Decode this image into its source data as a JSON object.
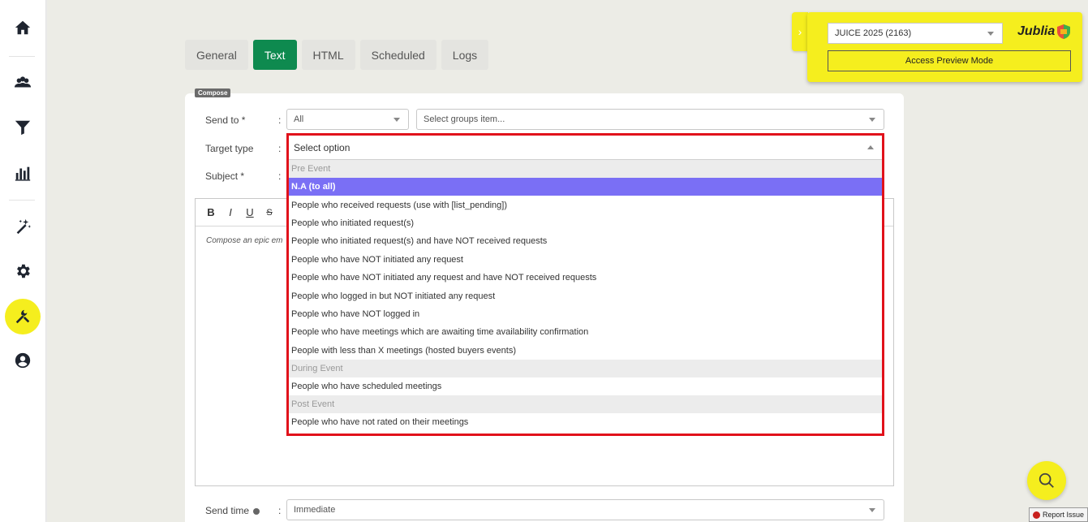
{
  "sidebar": {
    "items": [
      {
        "name": "home-icon"
      },
      {
        "name": "users-icon"
      },
      {
        "name": "filter-icon"
      },
      {
        "name": "chart-bars-icon"
      },
      {
        "name": "magic-wand-icon"
      },
      {
        "name": "gear-icon"
      },
      {
        "name": "tools-icon",
        "active": true
      },
      {
        "name": "account-circle-icon"
      }
    ]
  },
  "tabs": [
    {
      "label": "General"
    },
    {
      "label": "Text",
      "active": true
    },
    {
      "label": "HTML"
    },
    {
      "label": "Scheduled"
    },
    {
      "label": "Logs"
    }
  ],
  "compose": {
    "badge": "Compose",
    "send_to_label": "Send to *",
    "send_to_value": "All",
    "groups_placeholder": "Select groups item...",
    "target_type_label": "Target type",
    "subject_label": "Subject *",
    "colon": ":",
    "editor_placeholder": "Compose an epic em",
    "toolbar": {
      "bold": "B",
      "italic": "I",
      "underline": "U",
      "strike": "S"
    },
    "send_time_label": "Send time",
    "send_time_value": "Immediate"
  },
  "dropdown": {
    "search_value": "Select option",
    "groups": [
      {
        "label": "Pre Event",
        "options": [
          {
            "label": "N.A (to all)",
            "selected": true
          },
          {
            "label": "People who received requests (use with [list_pending])"
          },
          {
            "label": "People who initiated request(s)"
          },
          {
            "label": "People who initiated request(s) and have NOT received requests"
          },
          {
            "label": "People who have NOT initiated any request"
          },
          {
            "label": "People who have NOT initiated any request and have NOT received requests"
          },
          {
            "label": "People who logged in but NOT initiated any request"
          },
          {
            "label": "People who have NOT logged in"
          },
          {
            "label": "People who have meetings which are awaiting time availability confirmation"
          },
          {
            "label": "People with less than X meetings (hosted buyers events)"
          }
        ]
      },
      {
        "label": "During Event",
        "options": [
          {
            "label": "People who have scheduled meetings"
          }
        ]
      },
      {
        "label": "Post Event",
        "options": [
          {
            "label": "People who have not rated on their meetings"
          }
        ]
      }
    ]
  },
  "preview": {
    "event_value": "JUICE 2025 (2163)",
    "brand": "Jublia",
    "button_label": "Access Preview Mode",
    "toggle_glyph": "›"
  },
  "report_issue": "Report Issue",
  "colors": {
    "accent_green": "#0e8a4f",
    "highlight_yellow": "#f5ee1e",
    "selected_option": "#7a6ff5",
    "outline_red": "#e1121b"
  }
}
